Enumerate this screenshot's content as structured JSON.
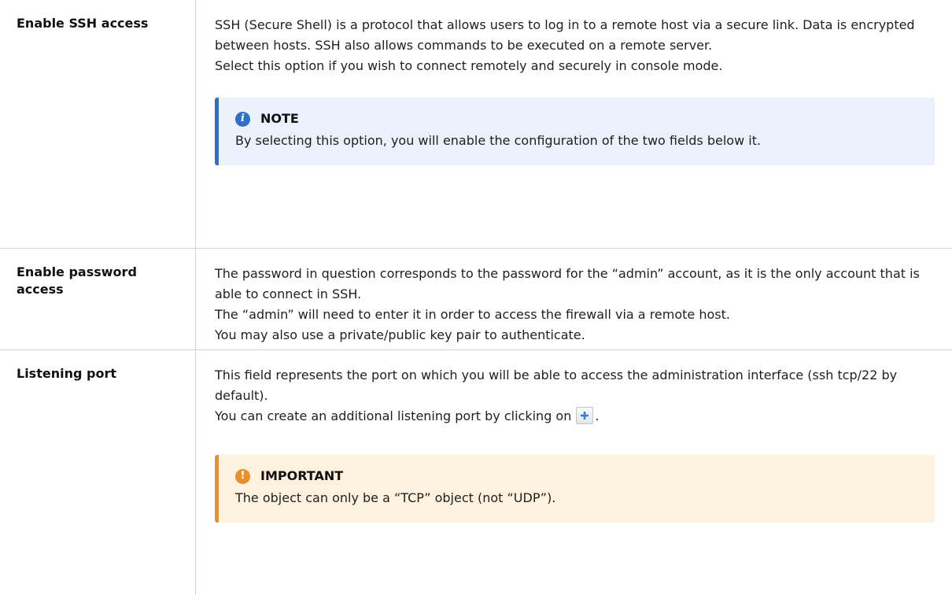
{
  "rows": [
    {
      "label": "Enable SSH access",
      "desc_lines": [
        "SSH (Secure Shell) is a protocol that allows users to log in to a remote host via a secure link. Data is encrypted between hosts. SSH also allows commands to be executed on a remote server.",
        "Select this option if you wish to connect remotely and securely in console mode."
      ],
      "note": {
        "title": "NOTE",
        "text": "By selecting this option, you will enable the configuration of the two fields below it."
      }
    },
    {
      "label": "Enable password access",
      "desc_lines": [
        "The password in question corresponds to the password for the “admin” account, as it is the only account that is able to connect in SSH.",
        "The “admin” will need to enter it in order to access the firewall via a remote host.",
        "You may also use a private/public key pair to authenticate."
      ]
    },
    {
      "label": "Listening port",
      "desc_lines": [
        "This field represents the port on which you will be able to access the administration interface (ssh tcp/22 by default)."
      ],
      "add_line_text": "You can create an additional listening port by clicking on",
      "add_line_end": ".",
      "important": {
        "title": "IMPORTANT",
        "text": "The object can only be a “TCP” object (not “UDP”)."
      }
    }
  ],
  "icons": {
    "note": "info-icon",
    "important": "exclamation-icon",
    "add": "plus-icon"
  },
  "colors": {
    "note_accent": "#2f6fc9",
    "note_bg": "#eaf1fb",
    "important_accent": "#e8902a",
    "important_bg": "#fdf2dd",
    "plus_icon": "#2f7fd6"
  }
}
